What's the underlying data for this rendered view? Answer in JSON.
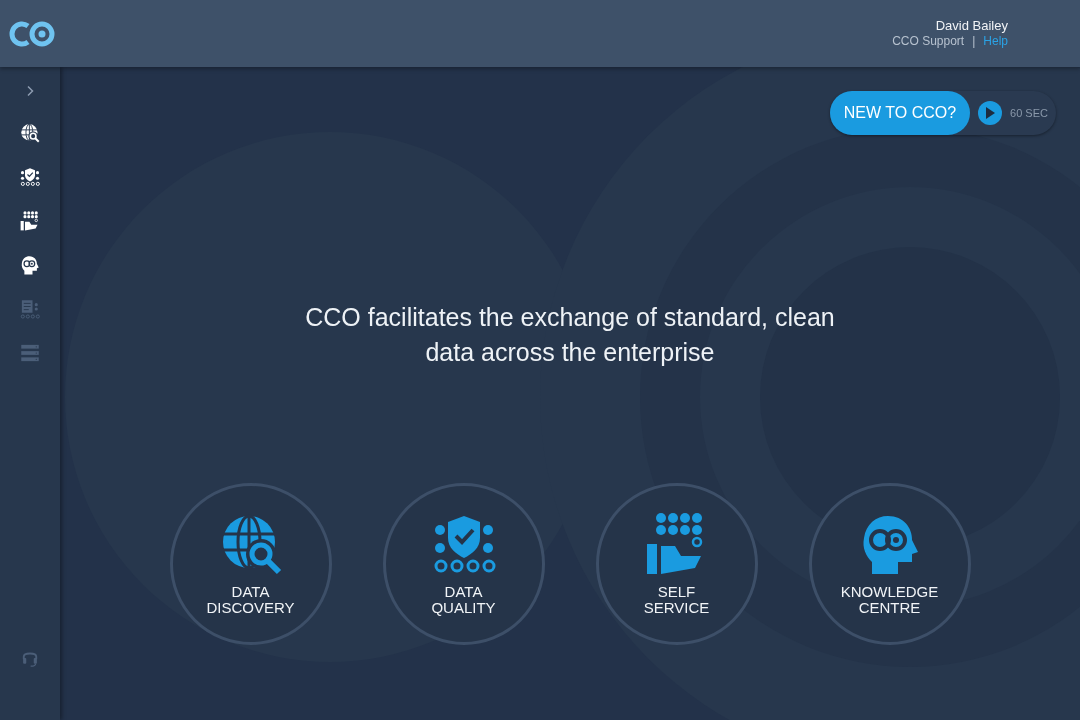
{
  "header": {
    "user_name": "David Bailey",
    "support_link": "CCO Support",
    "separator": "|",
    "help_link": "Help"
  },
  "sidebar": {
    "items": [
      {
        "kind": "expand",
        "disabled": false
      },
      {
        "kind": "discovery",
        "disabled": false
      },
      {
        "kind": "quality",
        "disabled": false
      },
      {
        "kind": "service",
        "disabled": false
      },
      {
        "kind": "knowledge",
        "disabled": false
      },
      {
        "kind": "report",
        "disabled": true
      },
      {
        "kind": "server",
        "disabled": true
      },
      {
        "kind": "support",
        "disabled": true
      }
    ]
  },
  "intro": {
    "button": "NEW TO CCO?",
    "video_length": "60 SEC"
  },
  "tagline": "CCO facilitates the exchange of standard, clean data across the enterprise",
  "features": [
    {
      "kind": "discovery",
      "label": "DATA\nDISCOVERY"
    },
    {
      "kind": "quality",
      "label": "DATA\nQUALITY"
    },
    {
      "kind": "service",
      "label": "SELF\nSERVICE"
    },
    {
      "kind": "knowledge",
      "label": "KNOWLEDGE\nCENTRE"
    }
  ]
}
